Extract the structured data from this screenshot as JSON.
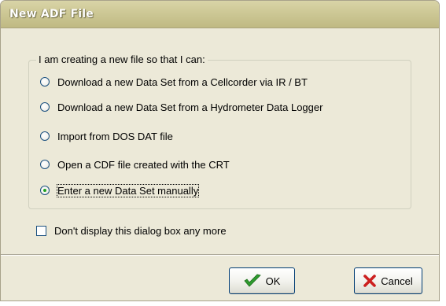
{
  "window": {
    "title": "New ADF File"
  },
  "group": {
    "legend": "I am creating a new file so that I can:",
    "options": [
      {
        "label": "Download a new Data Set from a Cellcorder via IR / BT",
        "selected": false
      },
      {
        "label": "Download a new Data Set from a Hydrometer Data Logger",
        "selected": false
      },
      {
        "label": "Import from DOS DAT file",
        "selected": false
      },
      {
        "label": "Open a CDF file created with the CRT",
        "selected": false
      },
      {
        "label": "Enter a new Data Set manually",
        "selected": true
      }
    ]
  },
  "checkbox": {
    "label": "Don't display this dialog box any more",
    "checked": false
  },
  "buttons": {
    "ok_label": "OK",
    "cancel_label": "Cancel"
  },
  "icons": {
    "ok": "checkmark-icon",
    "cancel": "x-icon"
  },
  "colors": {
    "titlebar": "#cdc895",
    "dialog_bg": "#ece9d8",
    "ok_check": "#2e9b2e",
    "cancel_x": "#cc1f1f"
  }
}
